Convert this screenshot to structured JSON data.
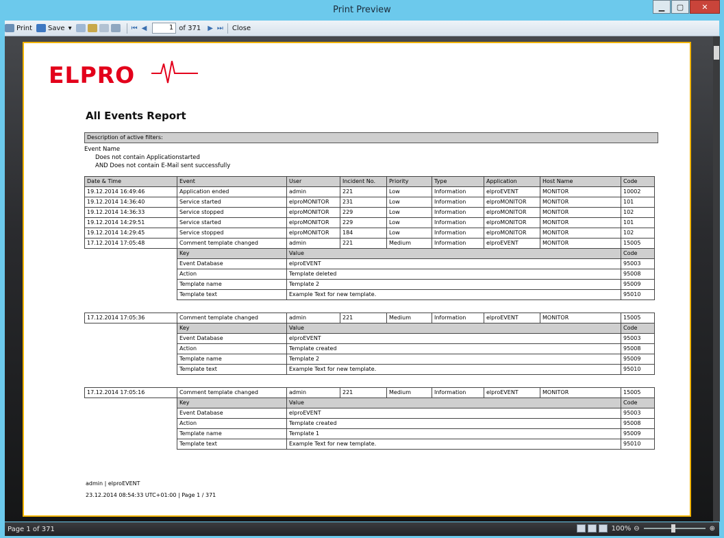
{
  "window": {
    "title": "Print Preview"
  },
  "toolbar": {
    "print": "Print",
    "save": "Save",
    "page_value": "1",
    "page_of": "of 371",
    "close": "Close"
  },
  "report": {
    "logo": "ELPRO",
    "title": "All Events Report",
    "filter_header": "Description of active filters:",
    "filter_lines": [
      "Event Name",
      "Does not contain Applicationstarted",
      "AND Does not contain E-Mail sent successfully"
    ],
    "columns": [
      "Date & Time",
      "Event",
      "User",
      "Incident No.",
      "Priority",
      "Type",
      "Application",
      "Host Name",
      "Code"
    ],
    "rows": [
      [
        "19.12.2014 16:49:46",
        "Application ended",
        "admin",
        "221",
        "Low",
        "Information",
        "elproEVENT",
        "MONITOR",
        "10002"
      ],
      [
        "19.12.2014 14:36:40",
        "Service started",
        "elproMONITOR",
        "231",
        "Low",
        "Information",
        "elproMONITOR",
        "MONITOR",
        "101"
      ],
      [
        "19.12.2014 14:36:33",
        "Service stopped",
        "elproMONITOR",
        "229",
        "Low",
        "Information",
        "elproMONITOR",
        "MONITOR",
        "102"
      ],
      [
        "19.12.2014 14:29:51",
        "Service started",
        "elproMONITOR",
        "229",
        "Low",
        "Information",
        "elproMONITOR",
        "MONITOR",
        "101"
      ],
      [
        "19.12.2014 14:29:45",
        "Service stopped",
        "elproMONITOR",
        "184",
        "Low",
        "Information",
        "elproMONITOR",
        "MONITOR",
        "102"
      ],
      [
        "17.12.2014 17:05:48",
        "Comment template changed",
        "admin",
        "221",
        "Medium",
        "Information",
        "elproEVENT",
        "MONITOR",
        "15005"
      ]
    ],
    "detail_columns": [
      "Key",
      "Value",
      "Code"
    ],
    "detail1": [
      [
        "Event Database",
        "elproEVENT",
        "95003"
      ],
      [
        "Action",
        "Template deleted",
        "95008"
      ],
      [
        "Template name",
        "Template 2",
        "95009"
      ],
      [
        "Template text",
        "Example Text for new template.",
        "95010"
      ]
    ],
    "group2": [
      "17.12.2014 17:05:36",
      "Comment template changed",
      "admin",
      "221",
      "Medium",
      "Information",
      "elproEVENT",
      "MONITOR",
      "15005"
    ],
    "detail2": [
      [
        "Event Database",
        "elproEVENT",
        "95003"
      ],
      [
        "Action",
        "Template created",
        "95008"
      ],
      [
        "Template name",
        "Template 2",
        "95009"
      ],
      [
        "Template text",
        "Example Text for new template.",
        "95010"
      ]
    ],
    "group3": [
      "17.12.2014 17:05:16",
      "Comment template changed",
      "admin",
      "221",
      "Medium",
      "Information",
      "elproEVENT",
      "MONITOR",
      "15005"
    ],
    "detail3": [
      [
        "Event Database",
        "elproEVENT",
        "95003"
      ],
      [
        "Action",
        "Template created",
        "95008"
      ],
      [
        "Template name",
        "Template 1",
        "95009"
      ],
      [
        "Template text",
        "Example Text for new template.",
        "95010"
      ]
    ],
    "footer_line1": "admin | elproEVENT",
    "footer_line2": "23.12.2014 08:54:33 UTC+01:00 | Page 1 / 371"
  },
  "status": {
    "page_text": "Page 1 of 371",
    "zoom": "100%"
  },
  "colors": {
    "title_bar": "#6cc9ec",
    "page_border": "#f2b400",
    "logo": "#e3001b",
    "close_button": "#c9443a"
  }
}
